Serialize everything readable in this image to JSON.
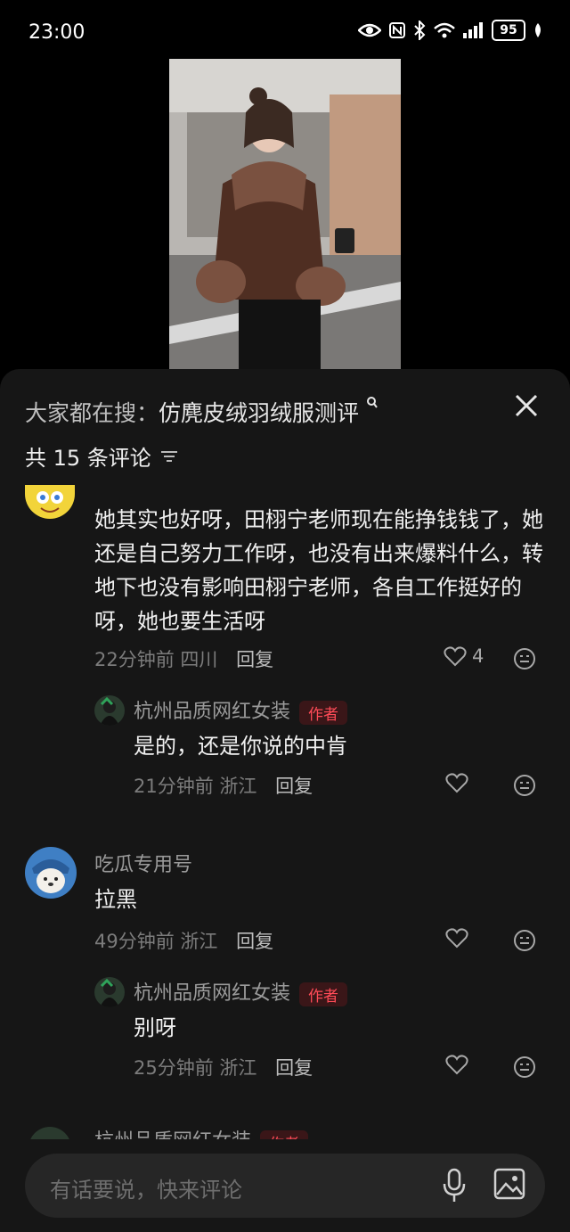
{
  "status_bar": {
    "time": "23:00",
    "battery": "95"
  },
  "sheet": {
    "search_prefix": "大家都在搜：",
    "search_query": "仿麂皮绒羽绒服测评",
    "comment_count": "共 15 条评论"
  },
  "comments": [
    {
      "text": "她其实也好呀，田栩宁老师现在能挣钱钱了，她还是自己努力工作呀，也没有出来爆料什么，转地下也没有影响田栩宁老师，各自工作挺好的呀，她也要生活呀",
      "time": "22分钟前",
      "region": "四川",
      "reply": "回复",
      "likes": "4"
    },
    {
      "name": "杭州品质网红女装",
      "tag": "作者",
      "text": "是的，还是你说的中肯",
      "time": "21分钟前",
      "region": "浙江",
      "reply": "回复"
    },
    {
      "name": "吃瓜专用号",
      "text": "拉黑",
      "time": "49分钟前",
      "region": "浙江",
      "reply": "回复"
    },
    {
      "name": "杭州品质网红女装",
      "tag": "作者",
      "text": "别呀",
      "time": "25分钟前",
      "region": "浙江",
      "reply": "回复"
    },
    {
      "name": "杭州品质网红女装",
      "tag": "作者"
    }
  ],
  "input": {
    "placeholder": "有话要说，快来评论"
  },
  "colors": {
    "sheet_bg": "#161616",
    "author_tag": "#ff4b57",
    "accent_text": "#e6e6e6"
  },
  "icons": [
    "eye-icon",
    "nfc-icon",
    "bluetooth-icon",
    "wifi-icon",
    "signal-icon",
    "battery-icon",
    "leaf-icon",
    "close-icon",
    "sort-icon",
    "heart-icon",
    "emoji-icon",
    "mic-icon",
    "image-icon"
  ]
}
